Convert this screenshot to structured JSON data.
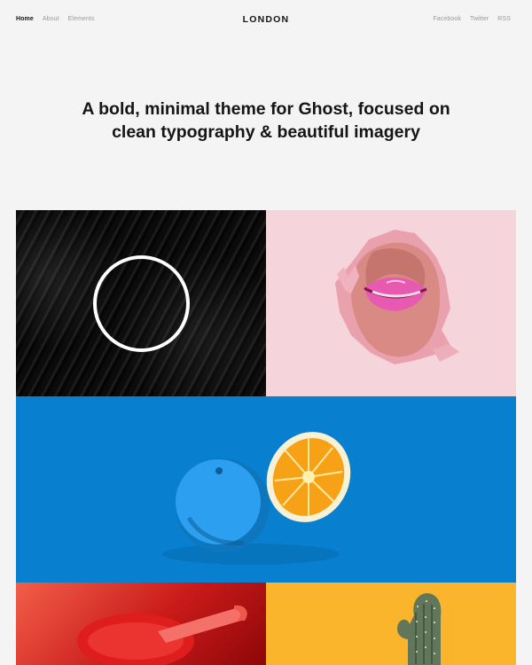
{
  "header": {
    "nav_left": [
      {
        "label": "Home",
        "active": true
      },
      {
        "label": "About",
        "active": false
      },
      {
        "label": "Elements",
        "active": false
      }
    ],
    "logo": "LONDON",
    "nav_right": [
      {
        "label": "Facebook"
      },
      {
        "label": "Twitter"
      },
      {
        "label": "RSS"
      }
    ]
  },
  "hero": {
    "title": "A bold, minimal theme for Ghost, focused on\nclean typography & beautiful imagery"
  },
  "gallery": {
    "tiles": [
      {
        "image": "dark-texture-circle-image"
      },
      {
        "image": "torn-paper-lips-image"
      },
      {
        "image": "blue-orange-fruit-image"
      },
      {
        "image": "red-drink-straw-image"
      },
      {
        "image": "cactus-yellow-background-image"
      }
    ]
  }
}
